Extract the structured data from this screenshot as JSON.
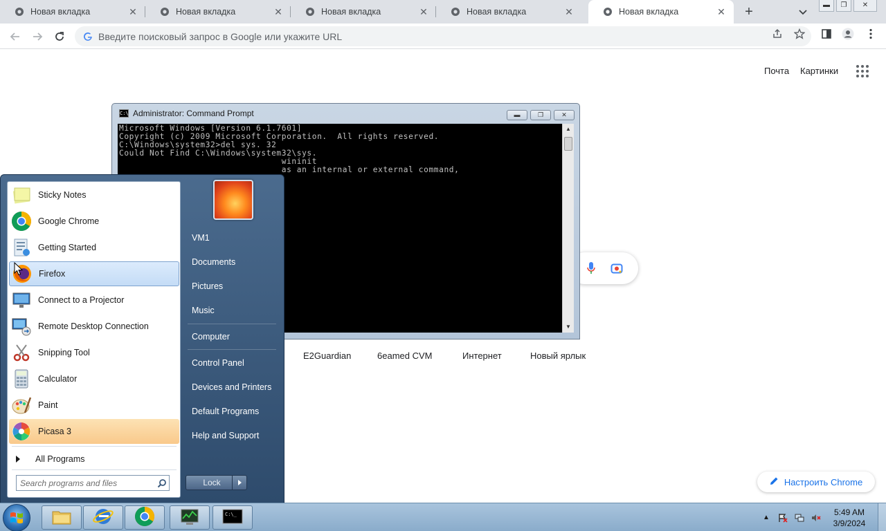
{
  "browser": {
    "tabs": [
      {
        "title": "Новая вкладка",
        "active": false
      },
      {
        "title": "Новая вкладка",
        "active": false
      },
      {
        "title": "Новая вкладка",
        "active": false
      },
      {
        "title": "Новая вкладка",
        "active": false
      },
      {
        "title": "Новая вкладка",
        "active": true
      }
    ],
    "omnibox_placeholder": "Введите поисковый запрос в Google или укажите URL"
  },
  "google_ntp": {
    "links": {
      "mail": "Почта",
      "images": "Картинки"
    },
    "shortcuts": [
      "E2Guardian",
      "6eamed CVM",
      "Интернет",
      "Новый ярлык"
    ],
    "customize_label": "Настроить Chrome"
  },
  "cmd": {
    "title": "Administrator: Command Prompt",
    "lines": [
      "Microsoft Windows [Version 6.1.7601]",
      "Copyright (c) 2009 Microsoft Corporation.  All rights reserved.",
      "",
      "C:\\Windows\\system32>del sys. 32",
      "Could Not Find C:\\Windows\\system32\\sys.",
      "",
      "                                wininit",
      "                                as an internal or external command,",
      "                                ."
    ]
  },
  "start_menu": {
    "programs": [
      {
        "label": "Sticky Notes",
        "icon": "sticky-notes-icon",
        "state": "normal"
      },
      {
        "label": "Google Chrome",
        "icon": "chrome-icon",
        "state": "normal"
      },
      {
        "label": "Getting Started",
        "icon": "getting-started-icon",
        "state": "normal"
      },
      {
        "label": "Firefox",
        "icon": "firefox-icon",
        "state": "hover"
      },
      {
        "label": "Connect to a Projector",
        "icon": "projector-icon",
        "state": "normal"
      },
      {
        "label": "Remote Desktop Connection",
        "icon": "remote-desktop-icon",
        "state": "normal"
      },
      {
        "label": "Snipping Tool",
        "icon": "snipping-tool-icon",
        "state": "normal"
      },
      {
        "label": "Calculator",
        "icon": "calculator-icon",
        "state": "normal"
      },
      {
        "label": "Paint",
        "icon": "paint-icon",
        "state": "normal"
      },
      {
        "label": "Picasa 3",
        "icon": "picasa-icon",
        "state": "new"
      }
    ],
    "all_programs": "All Programs",
    "search_placeholder": "Search programs and files",
    "right_items": [
      "VM1",
      "Documents",
      "Pictures",
      "Music",
      "Computer",
      "Control Panel",
      "Devices and Printers",
      "Default Programs",
      "Help and Support"
    ],
    "lock_label": "Lock"
  },
  "taskbar": {
    "pinned": [
      "explorer-icon",
      "ie-icon",
      "chrome-icon",
      "task-manager-icon",
      "cmd-icon"
    ],
    "time": "5:49 AM",
    "date": "3/9/2024"
  },
  "colors": {
    "chrome_tabstrip": "#dee1e6",
    "google_blue": "#1a73e8",
    "taskbar": "#a9c4dd",
    "start_menu": "#3d5c80",
    "firefox_hover": "#c4dcf6",
    "picasa_highlight": "#f9c98b"
  }
}
